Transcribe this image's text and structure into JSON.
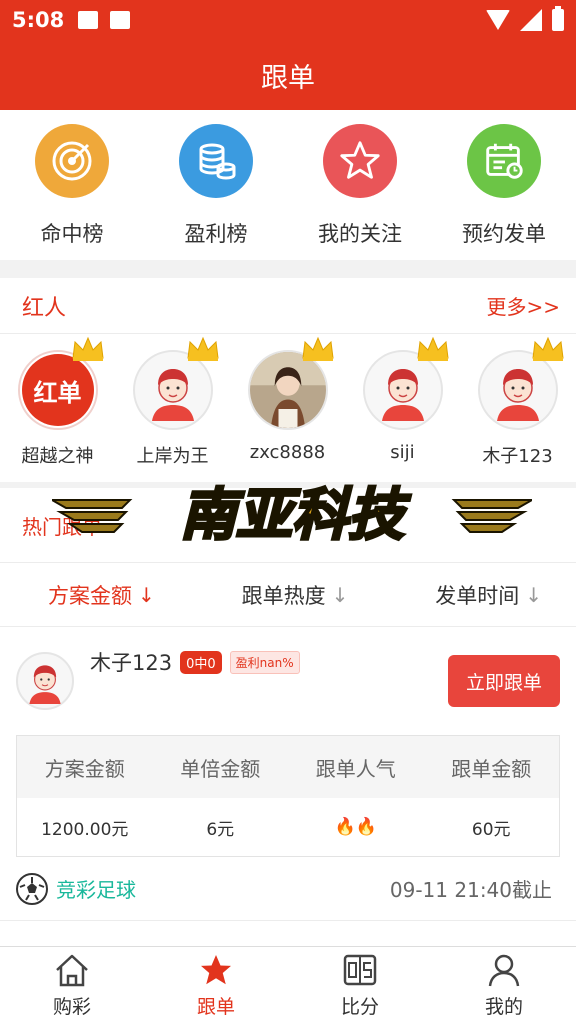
{
  "status_bar": {
    "time": "5:08"
  },
  "header": {
    "title": "跟单"
  },
  "quick_menu": [
    {
      "label": "命中榜",
      "icon": "target-icon",
      "color": "#efa83a"
    },
    {
      "label": "盈利榜",
      "icon": "coins-icon",
      "color": "#3b9be0"
    },
    {
      "label": "我的关注",
      "icon": "star-icon",
      "color": "#e95558"
    },
    {
      "label": "预约发单",
      "icon": "calendar-icon",
      "color": "#6cc546"
    }
  ],
  "hot_people": {
    "title": "红人",
    "more": "更多>>",
    "people": [
      {
        "name": "超越之神",
        "avatar": "red-badge",
        "badge_text": "红单"
      },
      {
        "name": "上岸为王",
        "avatar": "default"
      },
      {
        "name": "zxc8888",
        "avatar": "photo"
      },
      {
        "name": "siji",
        "avatar": "default"
      },
      {
        "name": "木子123",
        "avatar": "default"
      }
    ]
  },
  "watermark": {
    "text": "南亚科技"
  },
  "hot_follow": {
    "title": "热门跟单",
    "sort_options": [
      {
        "label": "方案金额",
        "arrow": "↓",
        "active": true
      },
      {
        "label": "跟单热度",
        "arrow": "↓",
        "active": false
      },
      {
        "label": "发单时间",
        "arrow": "↓",
        "active": false
      }
    ],
    "card": {
      "user_name": "木子123",
      "hit_tag": "0中0",
      "profit_tag": "盈利nan%",
      "follow_button": "立即跟单",
      "columns": [
        "方案金额",
        "单倍金额",
        "跟单人气",
        "跟单金额"
      ],
      "values": [
        "1200.00元",
        "6元",
        "🔥🔥",
        "60元"
      ],
      "lottery_name": "竞彩足球",
      "deadline": "09-11 21:40截止"
    }
  },
  "tab_bar": [
    {
      "label": "购彩",
      "icon": "home-icon",
      "active": false
    },
    {
      "label": "跟单",
      "icon": "star-icon",
      "active": true
    },
    {
      "label": "比分",
      "icon": "score-icon",
      "active": false
    },
    {
      "label": "我的",
      "icon": "user-icon",
      "active": false
    }
  ]
}
